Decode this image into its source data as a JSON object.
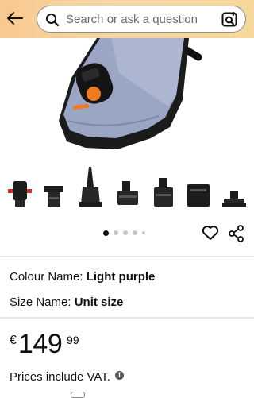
{
  "header": {
    "search_placeholder": "Search or ask a question",
    "icons": {
      "back": "arrow-left-icon",
      "search": "magnifier-icon",
      "lens": "camera-lens-icon"
    }
  },
  "gallery": {
    "image_count": 5,
    "active_index": 0,
    "accessory_icons": [
      "valve-adapter-red",
      "nozzle-short",
      "nozzle-needle",
      "nozzle-step",
      "nozzle-boston",
      "nozzle-wide",
      "nozzle-flat"
    ]
  },
  "actions": {
    "icons": [
      "heart-icon",
      "share-icon"
    ]
  },
  "variants": {
    "colour_label": "Colour Name:",
    "colour_value": "Light purple",
    "size_label": "Size Name:",
    "size_value": "Unit size"
  },
  "price": {
    "currency": "€",
    "whole": "149",
    "fraction": "99"
  },
  "vat_note": "Prices include VAT.",
  "colors": {
    "header_gradient_start": "#f9c98f",
    "header_gradient_end": "#f6d89b",
    "product_body": "#9aa6c4",
    "accent_orange": "#f07a1c"
  }
}
